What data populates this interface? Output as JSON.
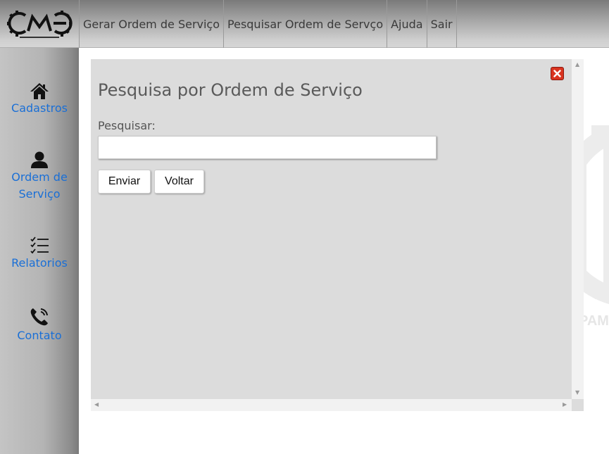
{
  "logo": {
    "text": "CME"
  },
  "nav": {
    "items": [
      "Gerar Ordem de Serviço",
      "Pesquisar Ordem de Servço",
      "Ajuda",
      "Sair"
    ]
  },
  "sidebar": {
    "items": [
      {
        "label": "Cadastros",
        "icon": "home-icon"
      },
      {
        "label": "Ordem de Serviço",
        "icon": "user-icon"
      },
      {
        "label": "Relatorios",
        "icon": "checklist-icon"
      },
      {
        "label": "Contato",
        "icon": "phone-icon"
      }
    ]
  },
  "panel": {
    "title": "Pesquisa por Ordem de Serviço",
    "search_label": "Pesquisar:",
    "search_value": "",
    "send_label": "Enviar",
    "back_label": "Voltar"
  },
  "colors": {
    "link": "#1a6fd6",
    "close": "#d9331f",
    "panel_bg": "#dcdcdc"
  }
}
